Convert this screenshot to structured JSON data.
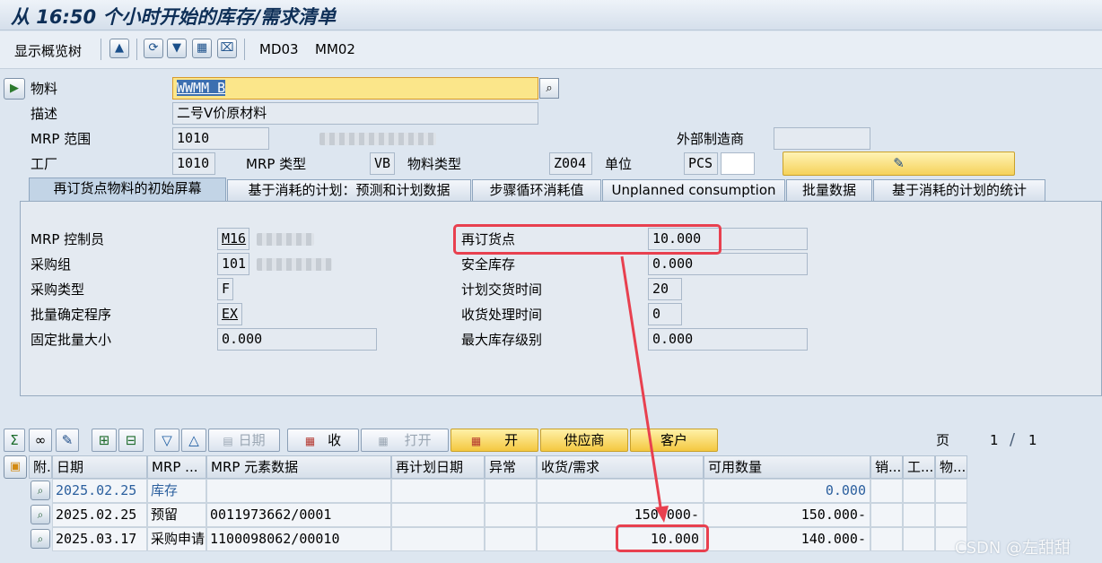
{
  "window": {
    "title": "从 16:50 个小时开始的库存/需求清单"
  },
  "toolbar": {
    "show_tree": "显示概览树",
    "md03": "MD03",
    "mm02": "MM02"
  },
  "header": {
    "material_label": "物料",
    "material_value": "WWMM B",
    "desc_label": "描述",
    "desc_value": "二号V价原材料",
    "mrp_area_label": "MRP 范围",
    "mrp_area_value": "1010",
    "ext_mfr_label": "外部制造商",
    "plant_label": "工厂",
    "plant_value": "1010",
    "mrp_type_label": "MRP 类型",
    "mrp_type_value": "VB",
    "mat_type_label": "物料类型",
    "mat_type_value": "Z004",
    "unit_label": "单位",
    "unit_value": "PCS"
  },
  "tabs": [
    "再订货点物料的初始屏幕",
    "基于消耗的计划：预测和计划数据",
    "步骤循环消耗值",
    "Unplanned consumption",
    "批量数据",
    "基于消耗的计划的统计"
  ],
  "panel": {
    "controller_label": "MRP 控制员",
    "controller_value": "M16",
    "pgroup_label": "采购组",
    "pgroup_value": "101",
    "ptype_label": "采购类型",
    "ptype_value": "F",
    "lotproc_label": "批量确定程序",
    "lotproc_value": "EX",
    "fixedlot_label": "固定批量大小",
    "fixedlot_value": "0.000",
    "reorder_label": "再订货点",
    "reorder_value": "10.000",
    "safety_label": "安全库存",
    "safety_value": "0.000",
    "pdt_label": "计划交货时间",
    "pdt_value": "20",
    "gr_label": "收货处理时间",
    "gr_value": "0",
    "maxstock_label": "最大库存级别",
    "maxstock_value": "0.000"
  },
  "grid_toolbar": {
    "date": "日期",
    "receipt": "收",
    "open_dis": "打开",
    "open": "开",
    "vendor": "供应商",
    "customer": "客户",
    "page_label": "页",
    "page": "1",
    "page_sep": "/",
    "pages": "1"
  },
  "columns": [
    "附.",
    "日期",
    "MRP ...",
    "MRP 元素数据",
    "再计划日期",
    "异常",
    "收货/需求",
    "可用数量",
    "销...",
    "工...",
    "物..."
  ],
  "rows": [
    {
      "date": "2025.02.25",
      "mrp": "库存",
      "data": "",
      "replan": "",
      "exc": "",
      "recv": "",
      "avail": "0.000"
    },
    {
      "date": "2025.02.25",
      "mrp": "预留",
      "data": "0011973662/0001",
      "replan": "",
      "exc": "",
      "recv": "150.000-",
      "avail": "150.000-"
    },
    {
      "date": "2025.03.17",
      "mrp": "采购申请",
      "data": "1100098062/00010",
      "replan": "",
      "exc": "",
      "recv": "10.000",
      "avail": "140.000-"
    }
  ],
  "watermark": "CSDN @左甜甜",
  "colors": {
    "annotation": "#e8404f",
    "highlight_field": "#fbe68a"
  }
}
